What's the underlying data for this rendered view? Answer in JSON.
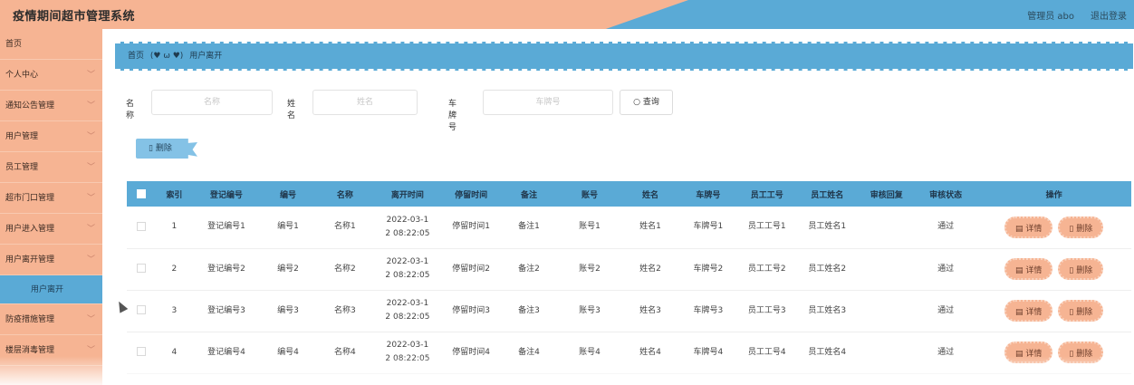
{
  "header": {
    "title": "疫情期间超市管理系统",
    "user": "管理员 abo",
    "logout": "退出登录"
  },
  "sidebar": {
    "items": [
      {
        "label": "首页",
        "has_arrow": false
      },
      {
        "label": "个人中心",
        "has_arrow": true
      },
      {
        "label": "通知公告管理",
        "has_arrow": true
      },
      {
        "label": "用户管理",
        "has_arrow": true
      },
      {
        "label": "员工管理",
        "has_arrow": true
      },
      {
        "label": "超市门口管理",
        "has_arrow": true
      },
      {
        "label": "用户进入管理",
        "has_arrow": true
      },
      {
        "label": "用户离开管理",
        "has_arrow": true
      }
    ],
    "sub_item": "用户离开",
    "items_after": [
      {
        "label": "防疫措施管理",
        "has_arrow": true
      },
      {
        "label": "楼层消毒管理",
        "has_arrow": true
      }
    ]
  },
  "breadcrumb": {
    "home": "首页",
    "emoticon": "(♥ ω ♥)",
    "current": "用户离开"
  },
  "search": {
    "name_label": "名称",
    "name_placeholder": "名称",
    "person_label": "姓名",
    "person_placeholder": "姓名",
    "plate_label": "车牌号",
    "plate_placeholder": "车牌号",
    "query_button": "查询"
  },
  "toolbar": {
    "delete_label": "删除"
  },
  "table": {
    "columns": [
      "索引",
      "登记编号",
      "编号",
      "名称",
      "离开时间",
      "停留时间",
      "备注",
      "账号",
      "姓名",
      "车牌号",
      "员工工号",
      "员工姓名",
      "审核回复",
      "审核状态",
      "操作"
    ],
    "rows": [
      {
        "index": "1",
        "reg_no": "登记编号1",
        "code": "编号1",
        "name": "名称1",
        "leave_time_1": "2022-03-1",
        "leave_time_2": "2 08:22:05",
        "stay": "停留时间1",
        "note": "备注1",
        "account": "账号1",
        "person": "姓名1",
        "plate": "车牌号1",
        "staff_no": "员工工号1",
        "staff_name": "员工姓名1",
        "reply": "",
        "status": "通过"
      },
      {
        "index": "2",
        "reg_no": "登记编号2",
        "code": "编号2",
        "name": "名称2",
        "leave_time_1": "2022-03-1",
        "leave_time_2": "2 08:22:05",
        "stay": "停留时间2",
        "note": "备注2",
        "account": "账号2",
        "person": "姓名2",
        "plate": "车牌号2",
        "staff_no": "员工工号2",
        "staff_name": "员工姓名2",
        "reply": "",
        "status": "通过"
      },
      {
        "index": "3",
        "reg_no": "登记编号3",
        "code": "编号3",
        "name": "名称3",
        "leave_time_1": "2022-03-1",
        "leave_time_2": "2 08:22:05",
        "stay": "停留时间3",
        "note": "备注3",
        "account": "账号3",
        "person": "姓名3",
        "plate": "车牌号3",
        "staff_no": "员工工号3",
        "staff_name": "员工姓名3",
        "reply": "",
        "status": "通过"
      },
      {
        "index": "4",
        "reg_no": "登记编号4",
        "code": "编号4",
        "name": "名称4",
        "leave_time_1": "2022-03-1",
        "leave_time_2": "2 08:22:05",
        "stay": "停留时间4",
        "note": "备注4",
        "account": "账号4",
        "person": "姓名4",
        "plate": "车牌号4",
        "staff_no": "员工工号4",
        "staff_name": "员工姓名4",
        "reply": "",
        "status": "通过"
      }
    ],
    "detail_label": "详情",
    "delete_label": "删除"
  },
  "colors": {
    "peach": "#f6b493",
    "blue": "#5aaad6"
  }
}
